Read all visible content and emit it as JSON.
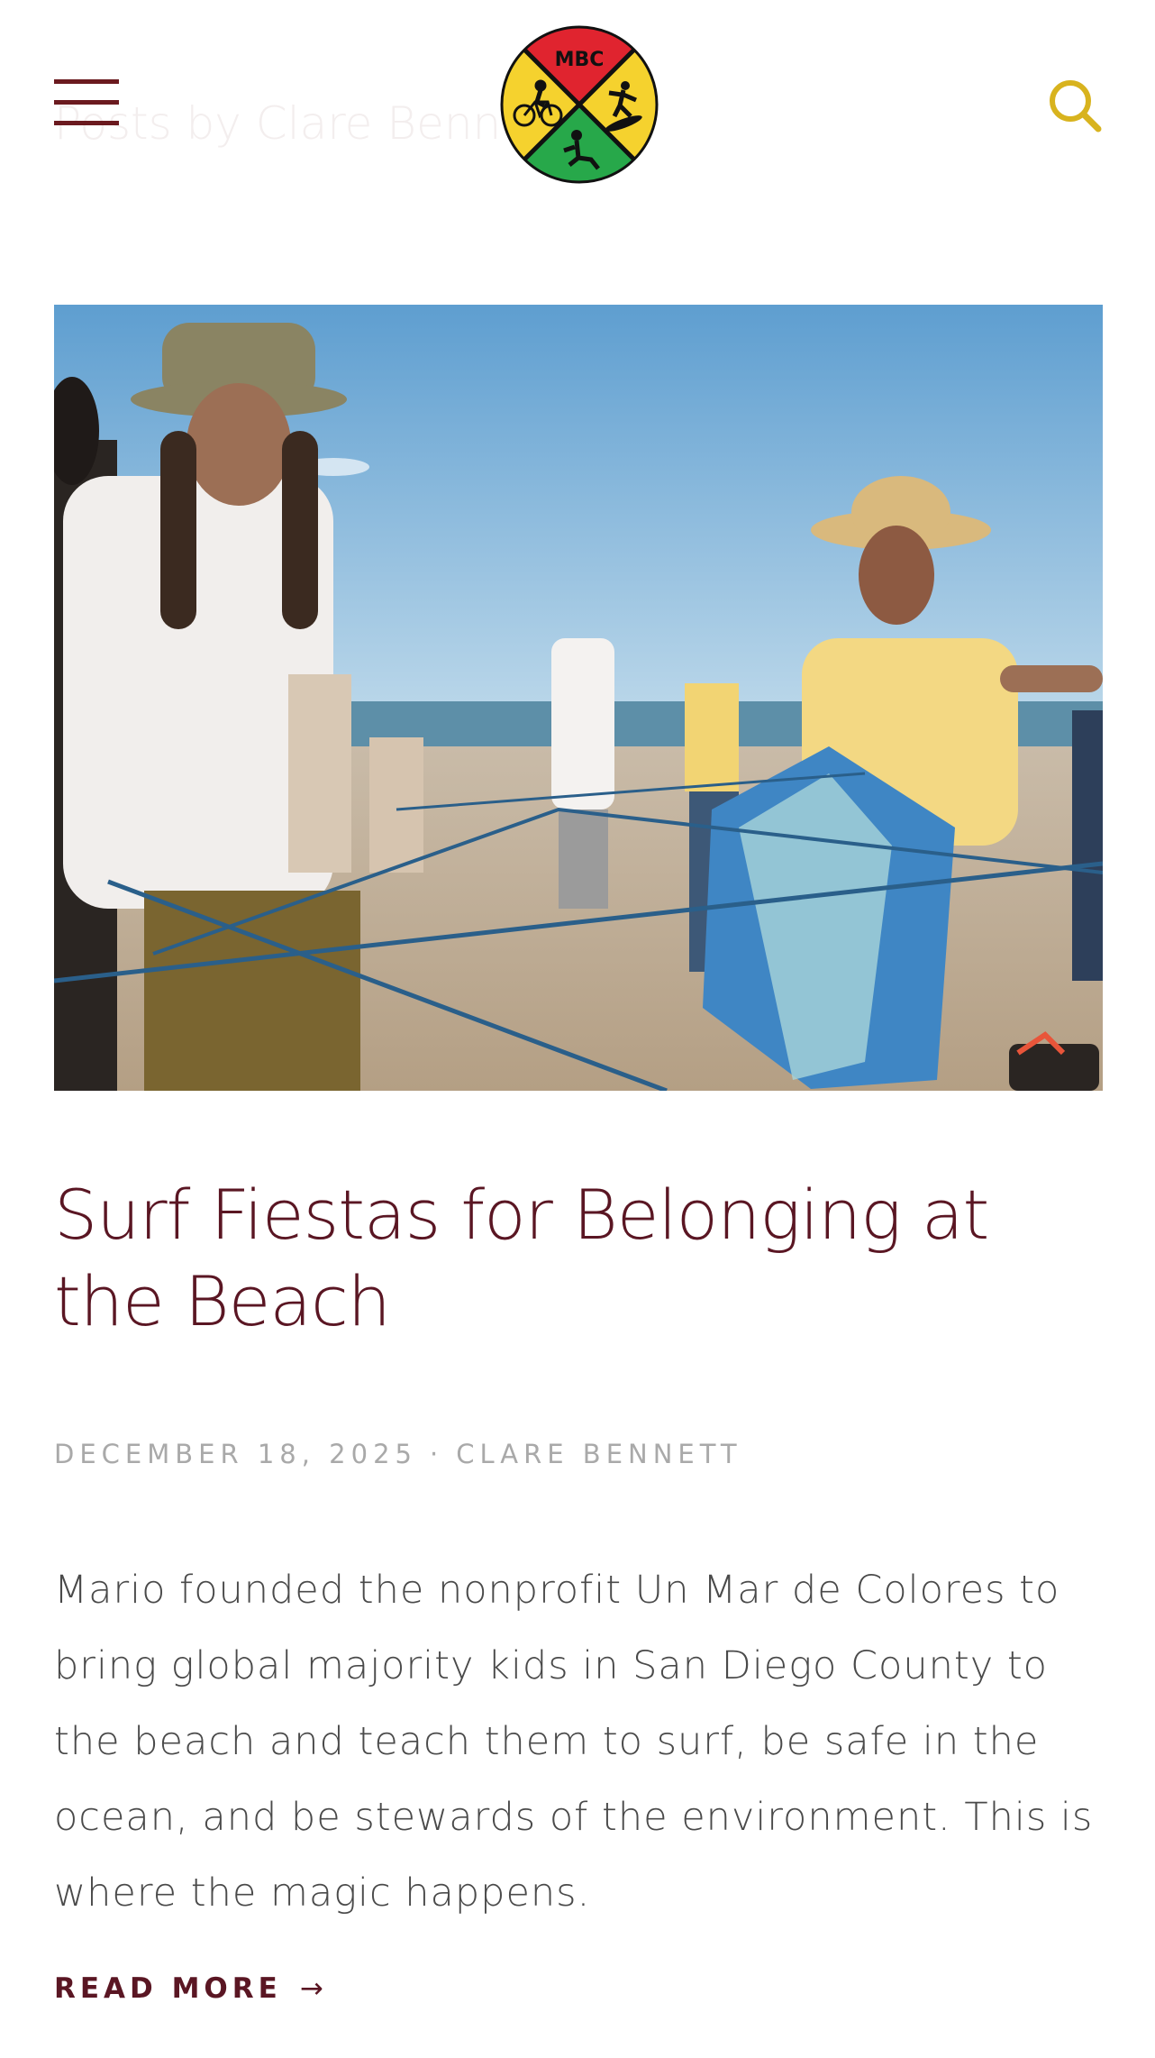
{
  "page": {
    "heading": "Posts by Clare Bennett"
  },
  "header": {
    "logo_text": "MBC",
    "logo_colors": [
      "#e0242f",
      "#f5d22e",
      "#27a84a",
      "#111111"
    ],
    "menu_icon": "hamburger-menu-icon",
    "search_icon": "search-icon",
    "accent_color": "#d8b31e",
    "menu_color": "#6b1a1f"
  },
  "post": {
    "title": "Surf Fiestas for Belonging at the Beach",
    "date": "DECEMBER 18, 2025",
    "separator": "·",
    "author": "CLARE BENNETT",
    "excerpt": "Mario founded the nonprofit Un Mar de Colores to bring global majority kids in San Diego County to the beach and teach them to surf, be safe in the ocean, and be stewards of the environment. This is where the magic happens.",
    "read_more_label": "READ MORE",
    "read_more_arrow": "→",
    "image_alt": "People holding blue ropes in a web on the beach",
    "title_color": "#5a1623"
  }
}
